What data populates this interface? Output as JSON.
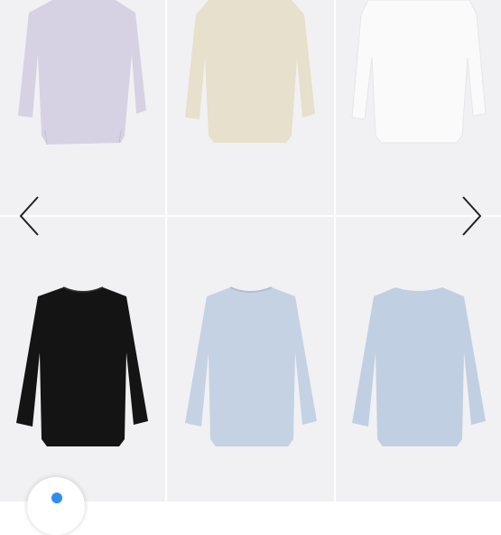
{
  "gallery": {
    "items": [
      {
        "name": "lavender-top",
        "color": "#d6d2e4"
      },
      {
        "name": "beige-top",
        "color": "#e6e0cc"
      },
      {
        "name": "white-top",
        "color": "#f4f4f6"
      },
      {
        "name": "black-top",
        "color": "#141414"
      },
      {
        "name": "light-blue-top",
        "color": "#c5d2e4"
      },
      {
        "name": "light-blue-top-back",
        "color": "#c1cfe2"
      }
    ],
    "prev_icon": "chevron-left-icon",
    "next_icon": "chevron-right-icon"
  },
  "fab": {
    "icon": "info-icon",
    "accent": "#2f8ff0"
  }
}
